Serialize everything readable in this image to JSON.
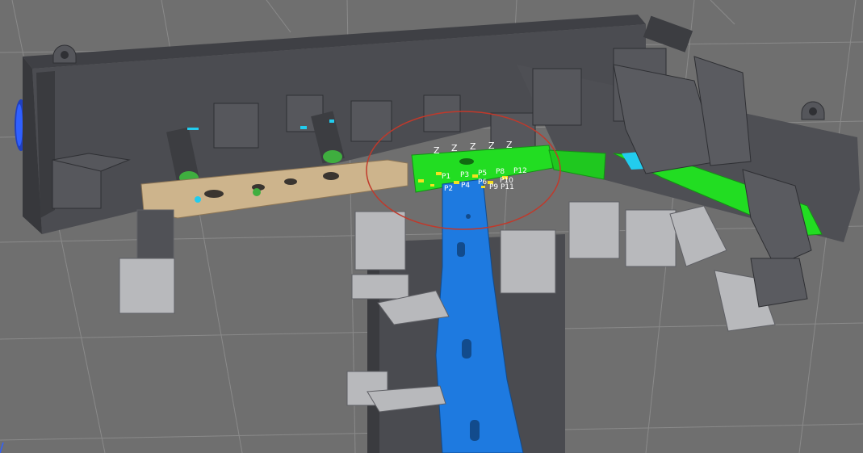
{
  "viewport": {
    "background": "#6f6f6f",
    "grid_color": "#8a8a8a"
  },
  "colors": {
    "fixture_dark": "#4a4b50",
    "fixture_mid": "#5e5f64",
    "clamp_light": "#b8b9bc",
    "beige_part": "#cdb48c",
    "green_part": "#22dd22",
    "blue_part": "#1e7ae0",
    "cyan_accent": "#22ccee",
    "highlight_ring": "#c0392b",
    "weld_marker": "#f4e020"
  },
  "annotation": {
    "shape": "ellipse",
    "color": "#c0392b",
    "meaning": "highlighted weld region"
  },
  "z_labels": [
    "Z",
    "Z",
    "Z",
    "Z",
    "Z"
  ],
  "weld_labels": [
    "P1",
    "P3",
    "P5",
    "P8",
    "P12",
    "P2",
    "P4",
    "P6",
    "P9",
    "P10",
    "P11"
  ],
  "icons": {
    "handle": "blue-axis-handle-icon",
    "corner": "view-axis-corner-icon"
  }
}
